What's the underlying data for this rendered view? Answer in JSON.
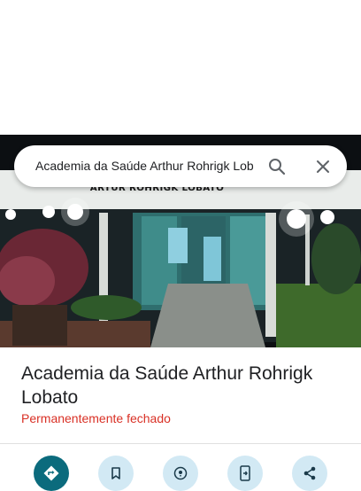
{
  "search": {
    "query": "Academia da Saúde Arthur Rohrigk Lobato",
    "search_icon": "search-icon",
    "close_icon": "close-icon"
  },
  "photo": {
    "sign_text": "ARTUR ROHRIGK LOBATO"
  },
  "place": {
    "name": "Academia da Saúde Arthur Rohrigk Lobato",
    "status": "Permanentemente fechado",
    "status_color": "#d93025"
  },
  "actions": [
    {
      "icon": "directions-icon",
      "color": "#0b6b7d"
    },
    {
      "icon": "bookmark-icon",
      "color": "#d2e9f4"
    },
    {
      "icon": "nearby-icon",
      "color": "#d2e9f4"
    },
    {
      "icon": "send-to-phone-icon",
      "color": "#d2e9f4"
    },
    {
      "icon": "share-icon",
      "color": "#d2e9f4"
    }
  ]
}
